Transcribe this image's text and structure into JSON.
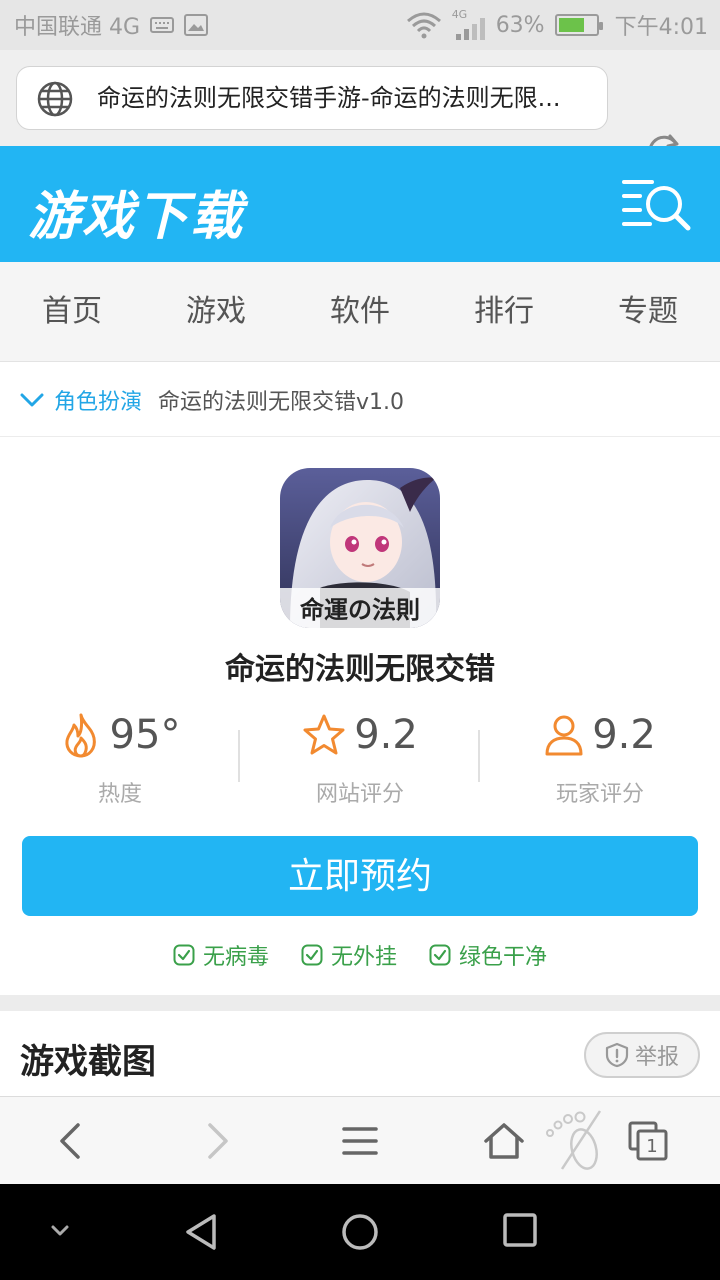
{
  "status_bar": {
    "carrier": "中国联通 4G",
    "network_tag": "4G",
    "battery": "63%",
    "time": "下午4:01"
  },
  "address_bar": {
    "url_text": "命运的法则无限交错手游-命运的法则无限..."
  },
  "header": {
    "logo": "游戏下载"
  },
  "nav": {
    "items": [
      "首页",
      "游戏",
      "软件",
      "排行",
      "专题"
    ]
  },
  "breadcrumb": {
    "category": "角色扮演",
    "current": "命运的法则无限交错v1.0"
  },
  "app": {
    "icon_caption": "命運の法則",
    "title": "命运的法则无限交错",
    "stats": [
      {
        "value": "95°",
        "label": "热度",
        "icon": "flame-icon"
      },
      {
        "value": "9.2",
        "label": "网站评分",
        "icon": "star-icon"
      },
      {
        "value": "9.2",
        "label": "玩家评分",
        "icon": "user-icon"
      }
    ],
    "book_button": "立即预约",
    "badges": [
      "无病毒",
      "无外挂",
      "绿色干净"
    ]
  },
  "screenshots": {
    "title": "游戏截图",
    "report_label": "举报"
  },
  "colors": {
    "brand": "#22b5f3",
    "orange": "#f28a30",
    "green": "#3aa04a"
  }
}
